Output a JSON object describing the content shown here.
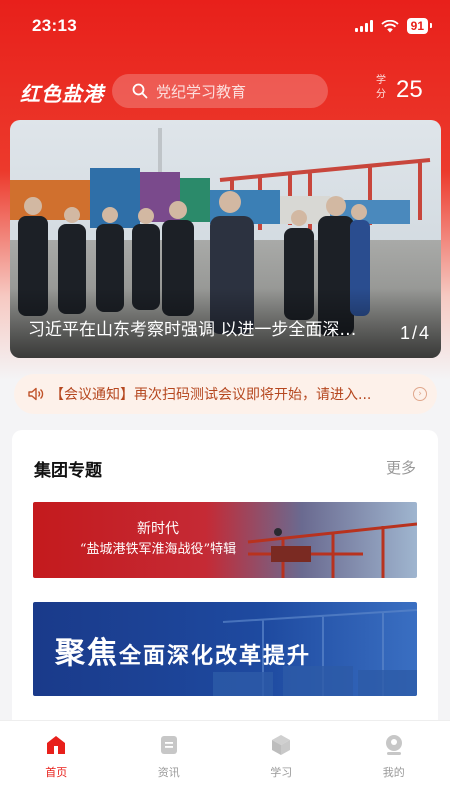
{
  "status": {
    "time": "23:13",
    "battery": "91"
  },
  "header": {
    "logo": "红色盐港",
    "search_placeholder": "党纪学习教育",
    "score_label": "学分",
    "score_value": "25"
  },
  "banner": {
    "caption": "习近平在山东考察时强调 以进一步全面深化改革为动力",
    "index": "1/4"
  },
  "notice": {
    "text": "【会议通知】再次扫码测试会议即将开始，请进入..."
  },
  "section": {
    "title": "集团专题",
    "more": "更多",
    "features": [
      {
        "line1": "新时代",
        "line2": "“盐城港铁军淮海战役”特辑"
      },
      {
        "big1": "聚",
        "big2": "焦",
        "rest": "全面深化改革提升"
      }
    ]
  },
  "tabs": [
    {
      "label": "首页",
      "icon": "home-icon",
      "active": true
    },
    {
      "label": "资讯",
      "icon": "news-icon",
      "active": false
    },
    {
      "label": "学习",
      "icon": "study-icon",
      "active": false
    },
    {
      "label": "我的",
      "icon": "profile-icon",
      "active": false
    }
  ],
  "colors": {
    "accent": "#e8201b",
    "notice_text": "#b5471f"
  }
}
